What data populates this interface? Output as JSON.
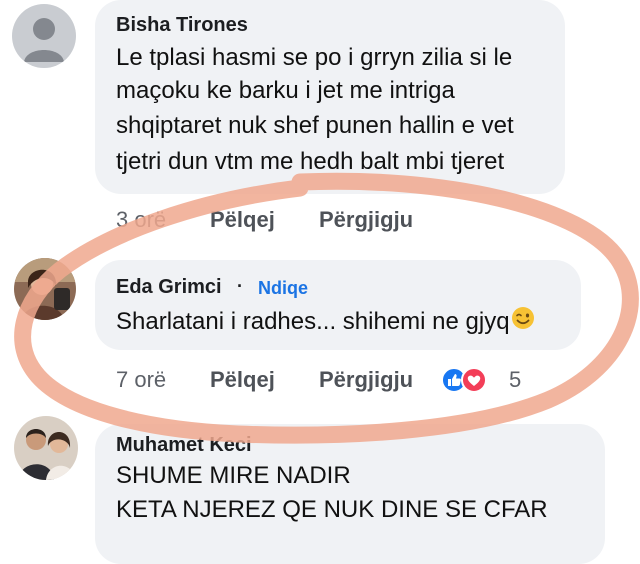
{
  "comments": [
    {
      "author": "Bisha Tirones",
      "lines": [
        "Le tplasi hasmi se po i grryn zilia si le",
        "maçoku ke barku i jet me intriga",
        "shqiptaret nuk shef punen hallin e vet",
        "tjetri dun vtm me hedh balt mbi tjeret"
      ],
      "time": "3 orë",
      "like_label": "Pëlqej",
      "reply_label": "Përgjigju"
    },
    {
      "author": "Eda Grimci",
      "separator": "·",
      "follow_label": "Ndiqe",
      "lines": [
        "Sharlatani i radhes... shihemi ne gjyq"
      ],
      "emoji": "winking-face-icon",
      "time": "7 orë",
      "like_label": "Pëlqej",
      "reply_label": "Përgjigju",
      "reactions": [
        "like-icon",
        "love-icon"
      ],
      "reaction_count": "5"
    },
    {
      "author": "Muhamet Keci",
      "lines": [
        "SHUME MIRE NADIR",
        "KETA NJEREZ QE NUK DINE SE CFAR"
      ]
    }
  ],
  "colors": {
    "bubble": "#f0f2f5",
    "link": "#1b74e4",
    "highlight_stroke": "#f0a88e",
    "like_blue": "#1877f2",
    "love_red": "#f33e58"
  }
}
